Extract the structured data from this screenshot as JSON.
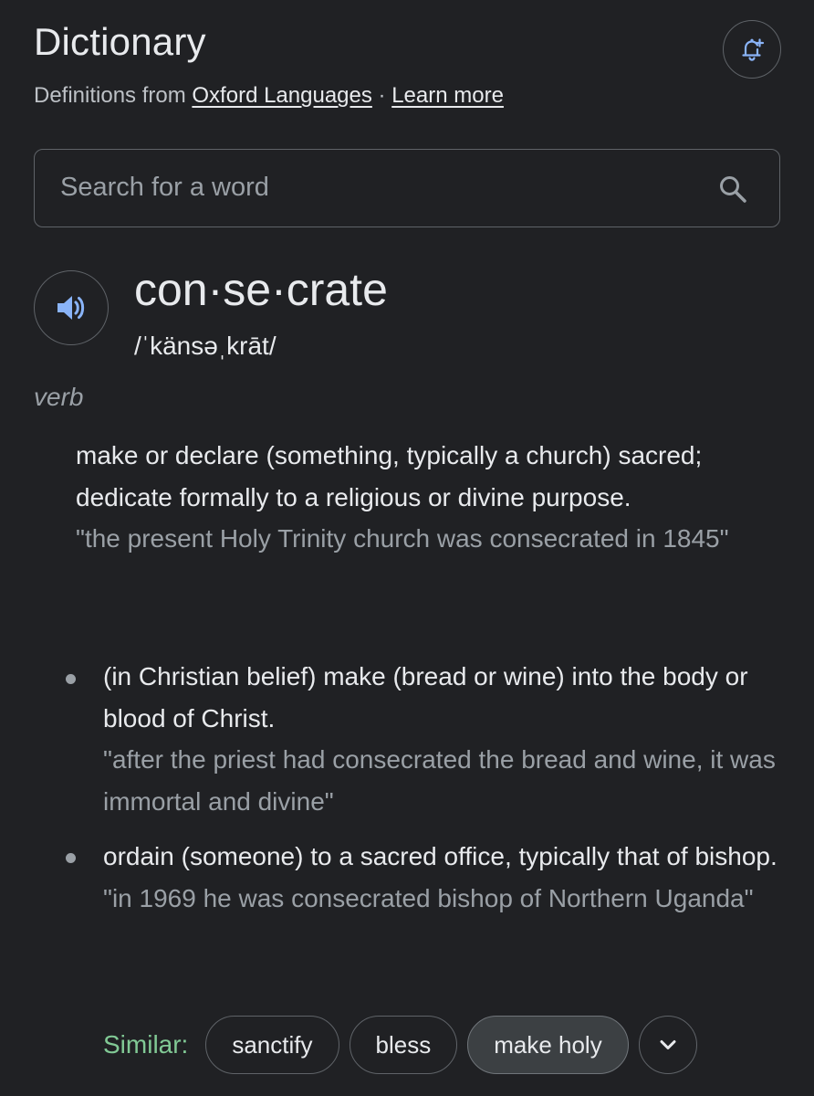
{
  "header": {
    "title": "Dictionary",
    "source_prefix": "Definitions from ",
    "source_link": "Oxford Languages",
    "separator": " · ",
    "learn_more": "Learn more",
    "bell_icon": "add-alert-bell-icon"
  },
  "search": {
    "placeholder": "Search for a word",
    "value": "",
    "icon": "search-icon"
  },
  "entry": {
    "speaker_icon": "volume-speaker-icon",
    "headword": "con·se·crate",
    "pronunciation": "/ˈkänsəˌkrāt/",
    "part_of_speech": "verb",
    "definition": "make or declare (something, typically a church) sacred; dedicate formally to a religious or divine purpose.",
    "example": "\"the present Holy Trinity church was consecrated in 1845\"",
    "sub_definitions": [
      {
        "definition": "(in Christian belief) make (bread or wine) into the body or blood of Christ.",
        "example": "\"after the priest had consecrated the bread and wine, it was immortal and divine\""
      },
      {
        "definition": "ordain (someone) to a sacred office, typically that of bishop.",
        "example": "\"in 1969 he was consecrated bishop of Northern Uganda\""
      }
    ]
  },
  "similar": {
    "label": "Similar:",
    "chips": [
      "sanctify",
      "bless",
      "make holy"
    ],
    "active_chip": "make holy",
    "expand_icon": "chevron-down-icon"
  },
  "colors": {
    "background": "#202124",
    "text_primary": "#e8eaed",
    "text_secondary": "#9aa0a6",
    "accent_blue": "#8ab4f8",
    "similar_green": "#81c995",
    "border": "#5f6368"
  }
}
